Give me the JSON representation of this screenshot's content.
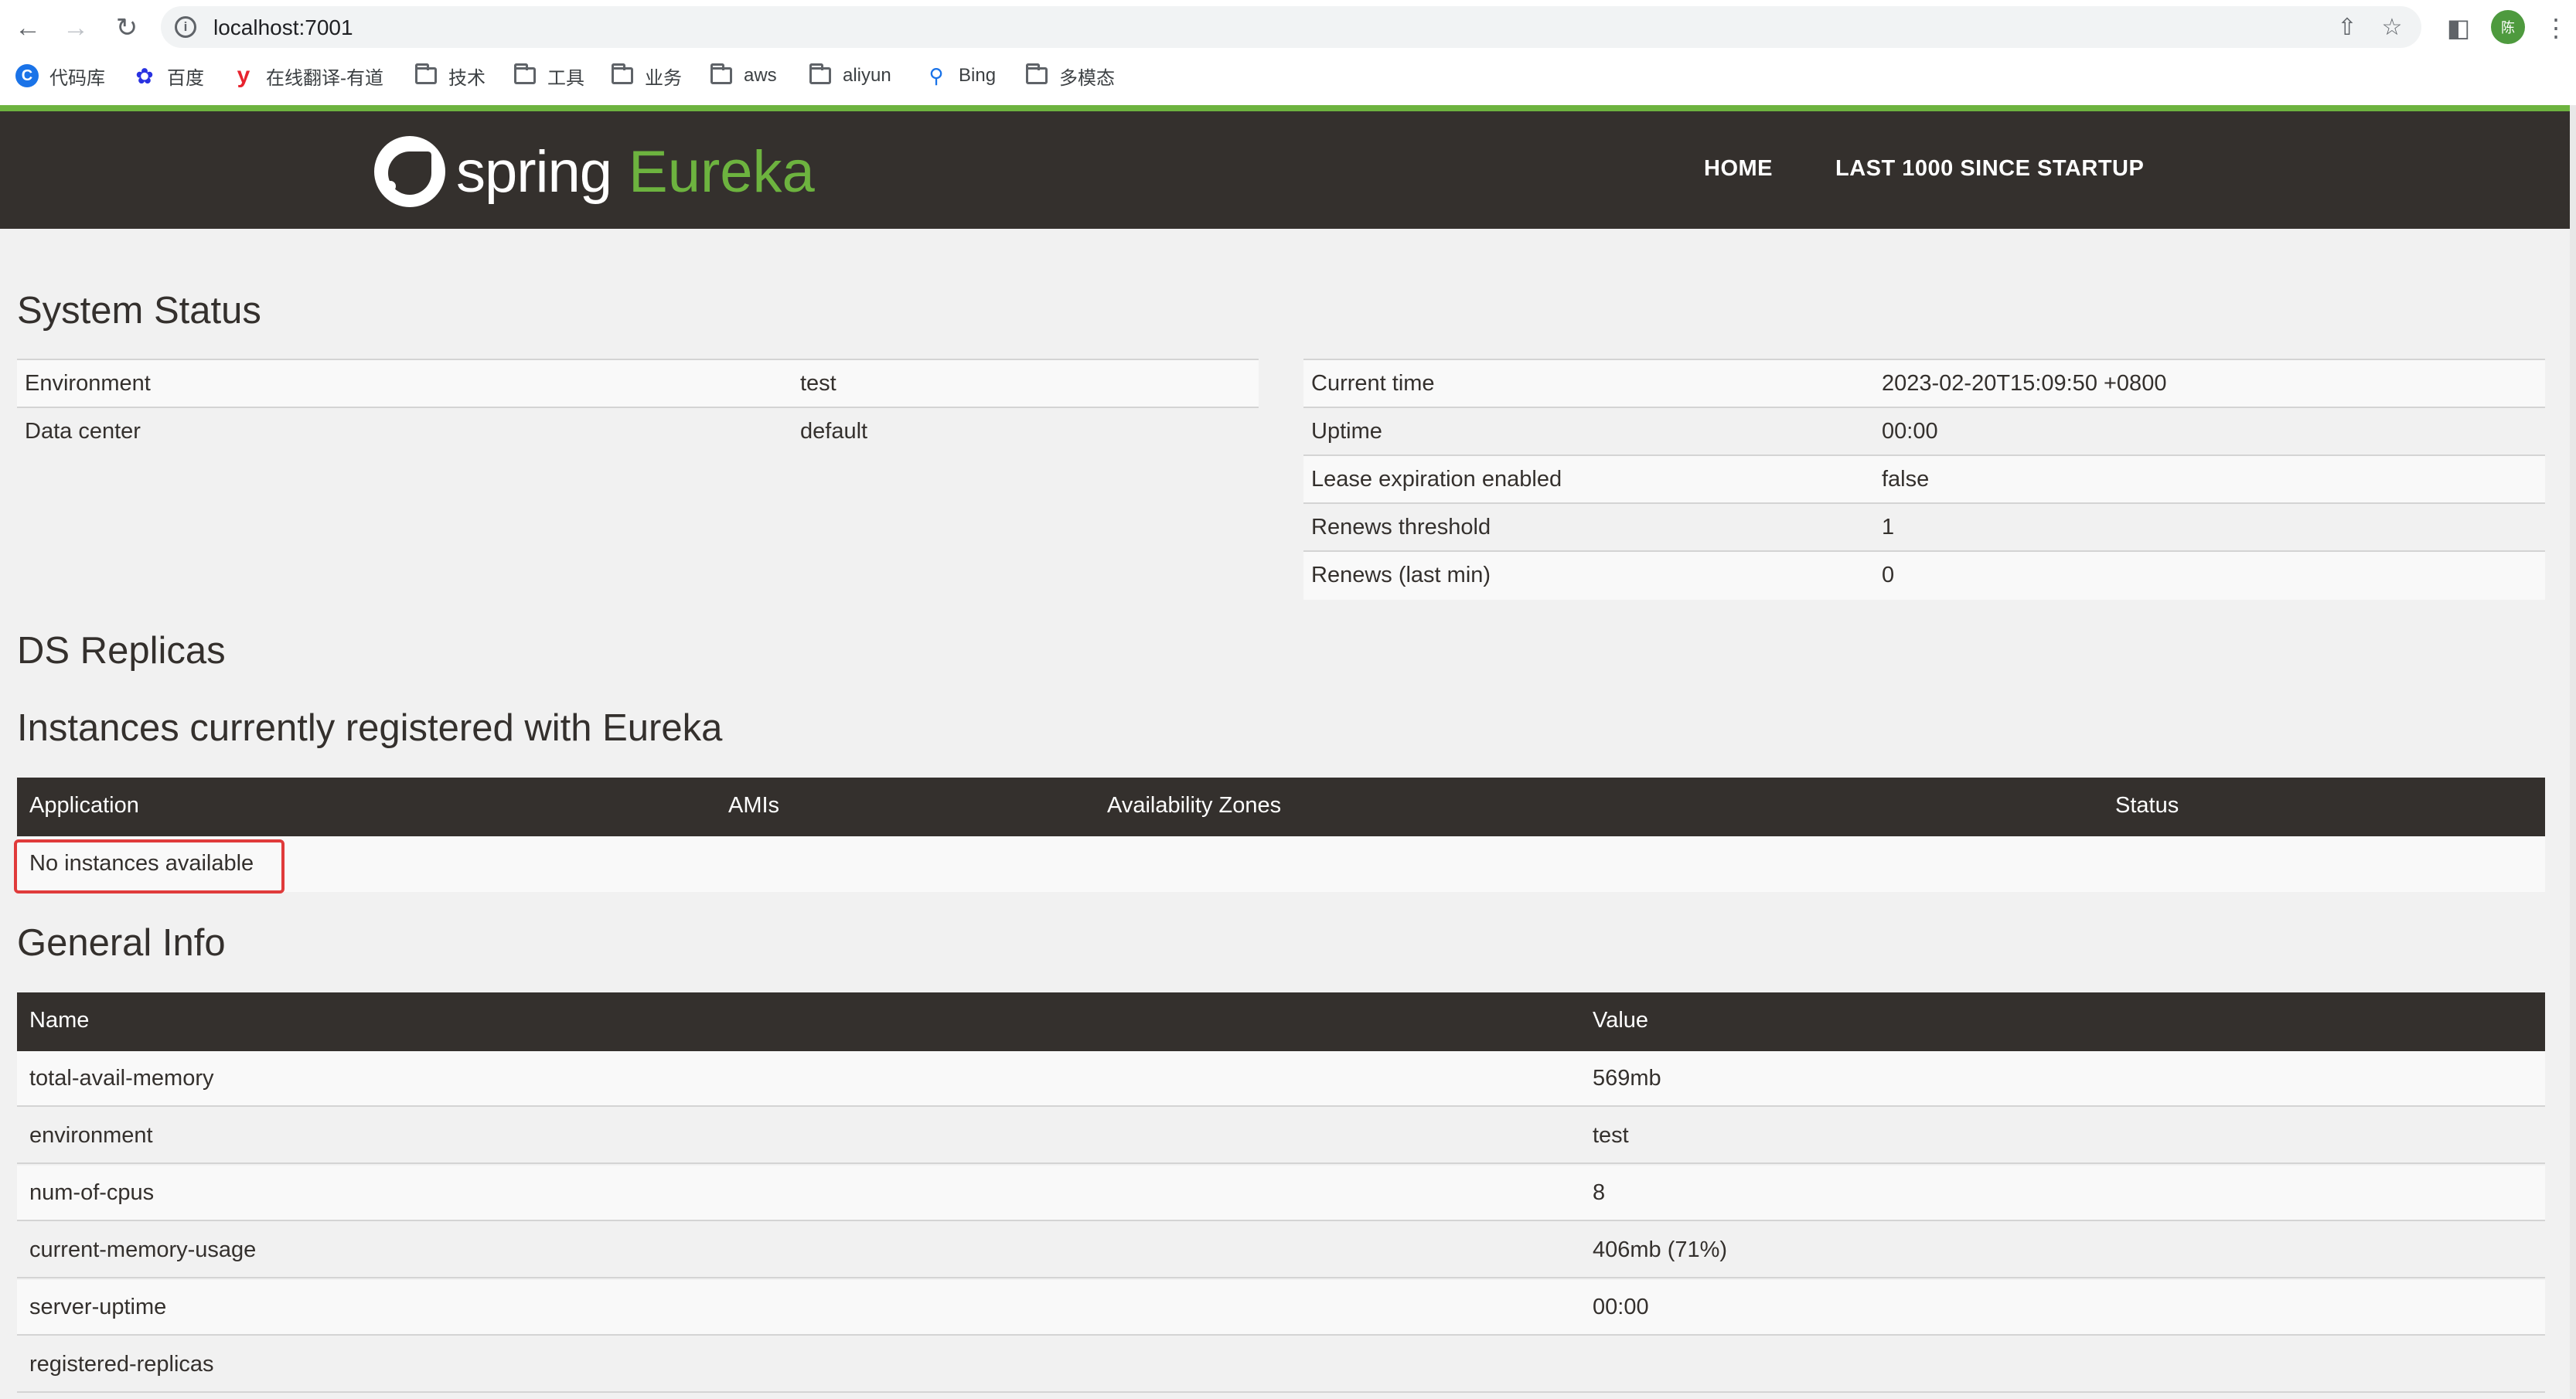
{
  "browser": {
    "url": "localhost:7001",
    "avatar_initial": "陈",
    "bookmarks": [
      {
        "label": "代码库",
        "icon": "chrome-c-icon"
      },
      {
        "label": "百度",
        "icon": "baidu-paw-icon"
      },
      {
        "label": "在线翻译-有道",
        "icon": "youdao-y-icon"
      },
      {
        "label": "技术",
        "icon": "folder-icon"
      },
      {
        "label": "工具",
        "icon": "folder-icon"
      },
      {
        "label": "业务",
        "icon": "folder-icon"
      },
      {
        "label": "aws",
        "icon": "folder-icon"
      },
      {
        "label": "aliyun",
        "icon": "folder-icon"
      },
      {
        "label": "Bing",
        "icon": "search-icon"
      },
      {
        "label": "多模态",
        "icon": "folder-icon"
      }
    ]
  },
  "header": {
    "logo_spring": "spring",
    "logo_eureka": "Eureka",
    "nav": [
      "HOME",
      "LAST 1000 SINCE STARTUP"
    ],
    "accent_color": "#6db33f",
    "bg_color": "#34302d"
  },
  "system_status": {
    "title": "System Status",
    "left": [
      {
        "key": "Environment",
        "value": "test"
      },
      {
        "key": "Data center",
        "value": "default"
      }
    ],
    "right": [
      {
        "key": "Current time",
        "value": "2023-02-20T15:09:50 +0800"
      },
      {
        "key": "Uptime",
        "value": "00:00"
      },
      {
        "key": "Lease expiration enabled",
        "value": "false"
      },
      {
        "key": "Renews threshold",
        "value": "1"
      },
      {
        "key": "Renews (last min)",
        "value": "0"
      }
    ]
  },
  "ds_replicas": {
    "title": "DS Replicas"
  },
  "instances": {
    "title": "Instances currently registered with Eureka",
    "columns": [
      "Application",
      "AMIs",
      "Availability Zones",
      "Status"
    ],
    "empty_text": "No instances available"
  },
  "general_info": {
    "title": "General Info",
    "columns": [
      "Name",
      "Value"
    ],
    "rows": [
      {
        "name": "total-avail-memory",
        "value": "569mb"
      },
      {
        "name": "environment",
        "value": "test"
      },
      {
        "name": "num-of-cpus",
        "value": "8"
      },
      {
        "name": "current-memory-usage",
        "value": "406mb (71%)"
      },
      {
        "name": "server-uptime",
        "value": "00:00"
      },
      {
        "name": "registered-replicas",
        "value": ""
      }
    ]
  }
}
